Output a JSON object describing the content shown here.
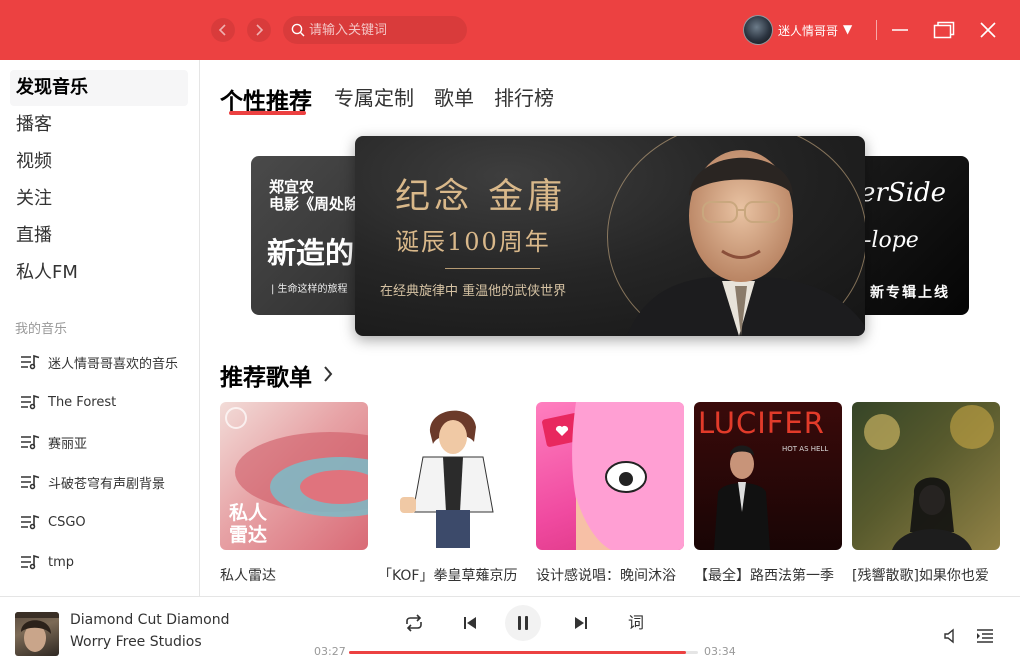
{
  "search": {
    "placeholder": "请输入关键词"
  },
  "user": {
    "name": "迷人情哥哥"
  },
  "sidebar": {
    "main_items": [
      "发现音乐",
      "播客",
      "视频",
      "关注",
      "直播",
      "私人FM"
    ],
    "section_label": "我的音乐",
    "playlists": [
      "迷人情哥哥喜欢的音乐",
      "The Forest",
      "赛丽亚",
      "斗破苍穹有声剧背景",
      "CSGO",
      "tmp"
    ]
  },
  "tabs": [
    "个性推荐",
    "专属定制",
    "歌单",
    "排行榜"
  ],
  "banner": {
    "left": {
      "line1": "郑宜农",
      "line2": "电影《周处除",
      "headline": "新造的",
      "caption": "| 生命这样的旅程"
    },
    "main": {
      "title": "纪念 金庸",
      "subtitle": "诞辰100周年",
      "caption": "在经典旋律中 重温他的武侠世界"
    },
    "right": {
      "line1": "erSide",
      "line2": "-lope",
      "caption": "新专辑上线"
    }
  },
  "recommend": {
    "title": "推荐歌单",
    "cards": [
      {
        "title": "私人雷达",
        "cover_text_1": "私人",
        "cover_text_2": "雷达"
      },
      {
        "title": "「KOF」拳皇草薙京历"
      },
      {
        "title": "设计感说唱：晚间沐浴"
      },
      {
        "title": "【最全】路西法第一季",
        "cover_text_1": "LUCIFER",
        "cover_text_2": "HOT AS HELL"
      },
      {
        "title": "[残響散歌]如果你也爱"
      }
    ]
  },
  "player": {
    "title": "Diamond Cut Diamond",
    "artist": "Worry Free Studios",
    "elapsed": "03:27",
    "duration": "03:34",
    "progress_fraction": 0.967,
    "lyric_label": "词"
  },
  "colors": {
    "accent": "#ec4141"
  }
}
